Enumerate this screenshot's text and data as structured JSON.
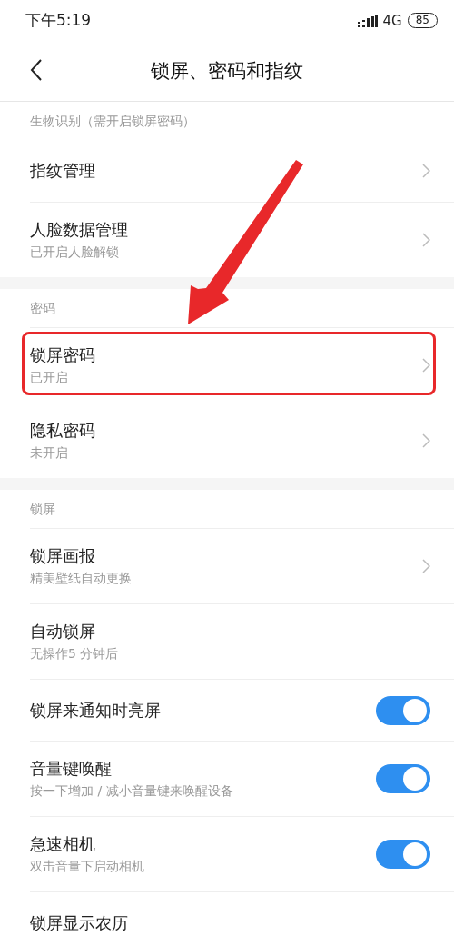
{
  "status_bar": {
    "time": "下午5:19",
    "network": "4G",
    "battery": "85"
  },
  "header": {
    "title": "锁屏、密码和指纹"
  },
  "sections": [
    {
      "title": "生物识别（需开启锁屏密码）",
      "items": [
        {
          "kind": "link",
          "title": "指纹管理",
          "highlighted": false
        },
        {
          "kind": "link",
          "title": "人脸数据管理",
          "subtitle": "已开启人脸解锁",
          "highlighted": false
        }
      ]
    },
    {
      "title": "密码",
      "items": [
        {
          "kind": "link",
          "title": "锁屏密码",
          "subtitle": "已开启",
          "highlighted": true
        },
        {
          "kind": "link",
          "title": "隐私密码",
          "subtitle": "未开启",
          "highlighted": false
        }
      ]
    },
    {
      "title": "锁屏",
      "items": [
        {
          "kind": "link",
          "title": "锁屏画报",
          "subtitle": "精美壁纸自动更换",
          "highlighted": false
        },
        {
          "kind": "plain",
          "title": "自动锁屏",
          "subtitle": "无操作5 分钟后",
          "highlighted": false
        },
        {
          "kind": "toggle",
          "title": "锁屏来通知时亮屏",
          "on": true,
          "highlighted": false
        },
        {
          "kind": "toggle",
          "title": "音量键唤醒",
          "subtitle": "按一下增加 / 减小音量键来唤醒设备",
          "on": true,
          "highlighted": false
        },
        {
          "kind": "toggle",
          "title": "急速相机",
          "subtitle": "双击音量下启动相机",
          "on": true,
          "highlighted": false
        },
        {
          "kind": "plain",
          "title": "锁屏显示农历",
          "highlighted": false
        }
      ]
    }
  ]
}
